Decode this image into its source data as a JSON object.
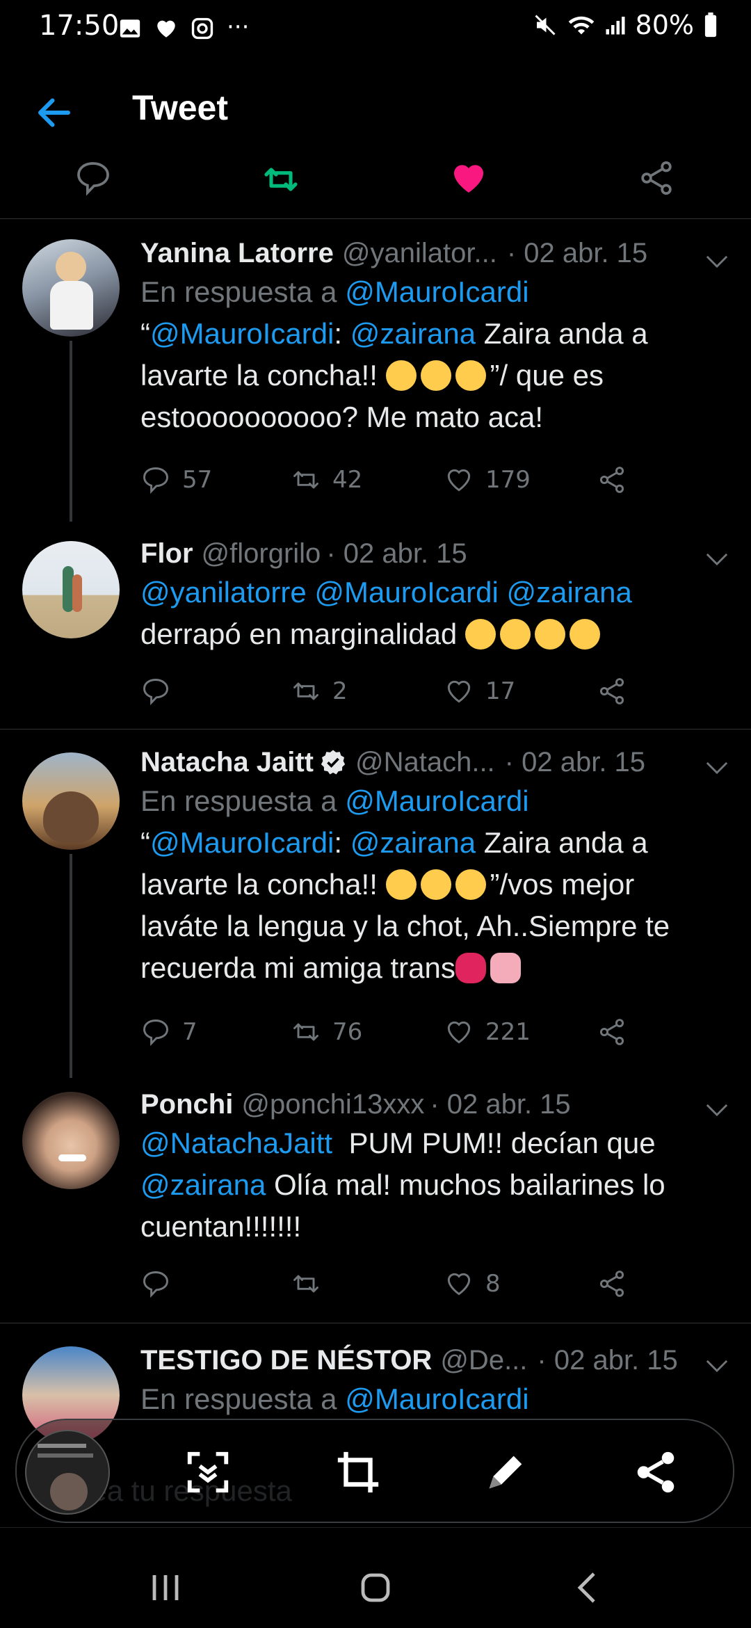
{
  "status_bar": {
    "time": "17:50",
    "battery": "80%"
  },
  "header": {
    "title": "Tweet"
  },
  "tweets": [
    {
      "name": "Yanina Latorre",
      "handle": "@yanilator...",
      "date": "· 02 abr. 15",
      "reply_prefix": "En respuesta a",
      "reply_to": "@MauroIcardi",
      "line1_pre": "“",
      "line1_link1": "@MauroIcardi",
      "line1_mid": ": ",
      "line1_link2": "@zairana",
      "line1_post": " Zaira anda a",
      "line2_pre": "lavarte la concha!! ",
      "line2_post": "”/ que es",
      "line3": "estoooooooooo? Me mato aca!",
      "replies": "57",
      "retweets": "42",
      "likes": "179"
    },
    {
      "name": "Flor",
      "handle": "@florgrilo",
      "date": "· 02 abr. 15",
      "line1_link1": "@yanilatorre",
      "line1_link2": "@MauroIcardi",
      "line1_link3": "@zairana",
      "line2": "derrapó en marginalidad ",
      "replies": "",
      "retweets": "2",
      "likes": "17"
    },
    {
      "name": "Natacha Jaitt",
      "handle": "@Natach...",
      "date": "· 02 abr. 15",
      "reply_prefix": "En respuesta a",
      "reply_to": "@MauroIcardi",
      "line1_pre": "“",
      "line1_link1": "@MauroIcardi",
      "line1_mid": ": ",
      "line1_link2": "@zairana",
      "line1_post": " Zaira anda a",
      "line2_pre": "lavarte la concha!! ",
      "line2_post": "”/vos mejor",
      "line3": "laváte la lengua y la chot, Ah..Siempre te",
      "line4": "recuerda mi amiga trans",
      "replies": "7",
      "retweets": "76",
      "likes": "221"
    },
    {
      "name": "Ponchi",
      "handle": "@ponchi13xxx",
      "date": "· 02 abr. 15",
      "line1_link1": "@NatachaJaitt",
      "line1_post": "  PUM PUM!! decían que",
      "line2_link1": "@zairana",
      "line2_post": " Olía mal! muchos bailarines lo",
      "line3": "cuentan!!!!!!!",
      "replies": "",
      "retweets": "",
      "likes": "8"
    },
    {
      "name": "TESTIGO DE NÉSTOR",
      "handle": "@De...",
      "date": "· 02 abr. 15",
      "reply_prefix": "En respuesta a",
      "reply_to": "@MauroIcardi"
    }
  ],
  "composer": {
    "placeholder": "Twittea tu respuesta"
  },
  "colors": {
    "accent": "#1d9bf0",
    "retweet": "#00ba7c",
    "like": "#f91880",
    "background": "#000000"
  },
  "icons": [
    "back-arrow-icon",
    "reply-icon",
    "retweet-icon",
    "like-icon",
    "share-icon",
    "scroll-capture-icon",
    "crop-icon",
    "draw-icon",
    "recent-apps-icon",
    "home-icon",
    "back-icon"
  ]
}
